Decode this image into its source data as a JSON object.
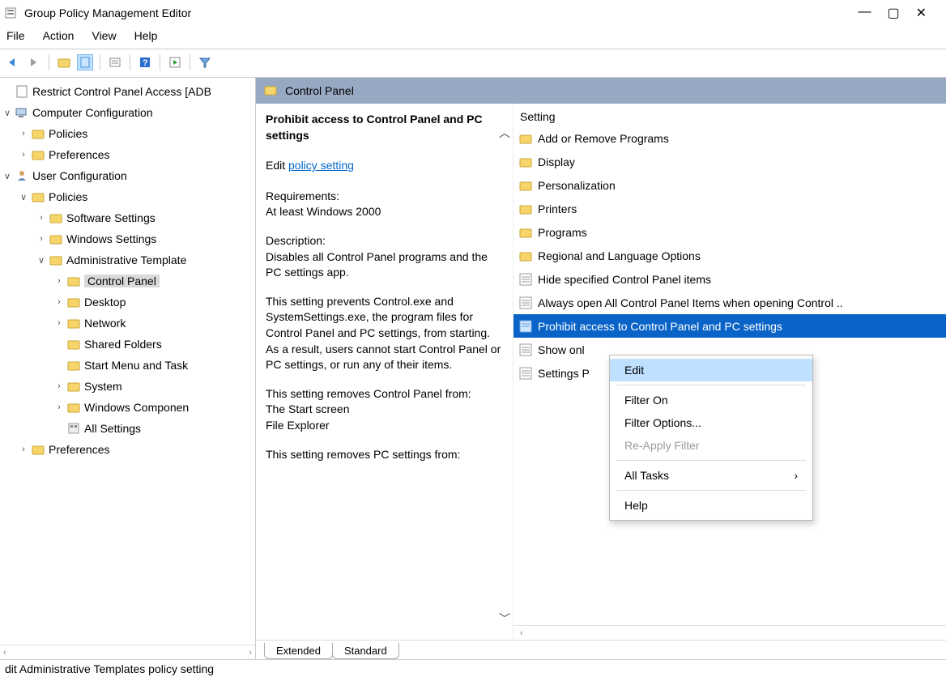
{
  "titlebar": {
    "title": "Group Policy Management Editor"
  },
  "menubar": {
    "file": "File",
    "action": "Action",
    "view": "View",
    "help": "Help"
  },
  "tree": {
    "root": "Restrict Control Panel Access [ADB",
    "comp_config": "Computer Configuration",
    "comp_policies": "Policies",
    "comp_prefs": "Preferences",
    "user_config": "User Configuration",
    "user_policies": "Policies",
    "soft_settings": "Software Settings",
    "win_settings": "Windows Settings",
    "admin_templates": "Administrative Template",
    "control_panel": "Control Panel",
    "desktop": "Desktop",
    "network": "Network",
    "shared_folders": "Shared Folders",
    "start_menu": "Start Menu and Task",
    "system": "System",
    "win_components": "Windows Componen",
    "all_settings": "All Settings",
    "user_prefs": "Preferences"
  },
  "content": {
    "header": "Control Panel",
    "setting_title": "Prohibit access to Control Panel and PC settings",
    "edit_prefix": "Edit ",
    "edit_link": "policy setting",
    "requirements_label": "Requirements:",
    "requirements_value": "At least Windows 2000",
    "description_label": "Description:",
    "description_p1": "Disables all Control Panel programs and the PC settings app.",
    "description_p2": "This setting prevents Control.exe and SystemSettings.exe, the program files for Control Panel and PC settings, from starting. As a result, users cannot start Control Panel or PC settings, or run any of their items.",
    "description_p3": "This setting removes Control Panel from:",
    "description_p3a": "The Start screen",
    "description_p3b": "File Explorer",
    "description_p4": "This setting removes PC settings from:"
  },
  "list": {
    "header": "Setting",
    "items": [
      "Add or Remove Programs",
      "Display",
      "Personalization",
      "Printers",
      "Programs",
      "Regional and Language Options",
      "Hide specified Control Panel items",
      "Always open All Control Panel Items when opening Control ..",
      "Prohibit access to Control Panel and PC settings",
      "Show onl",
      "Settings P"
    ]
  },
  "tabs": {
    "extended": "Extended",
    "standard": "Standard"
  },
  "context_menu": {
    "edit": "Edit",
    "filter_on": "Filter On",
    "filter_options": "Filter Options...",
    "reapply": "Re-Apply Filter",
    "all_tasks": "All Tasks",
    "help": "Help"
  },
  "statusbar": {
    "text": "dit Administrative Templates policy setting"
  }
}
